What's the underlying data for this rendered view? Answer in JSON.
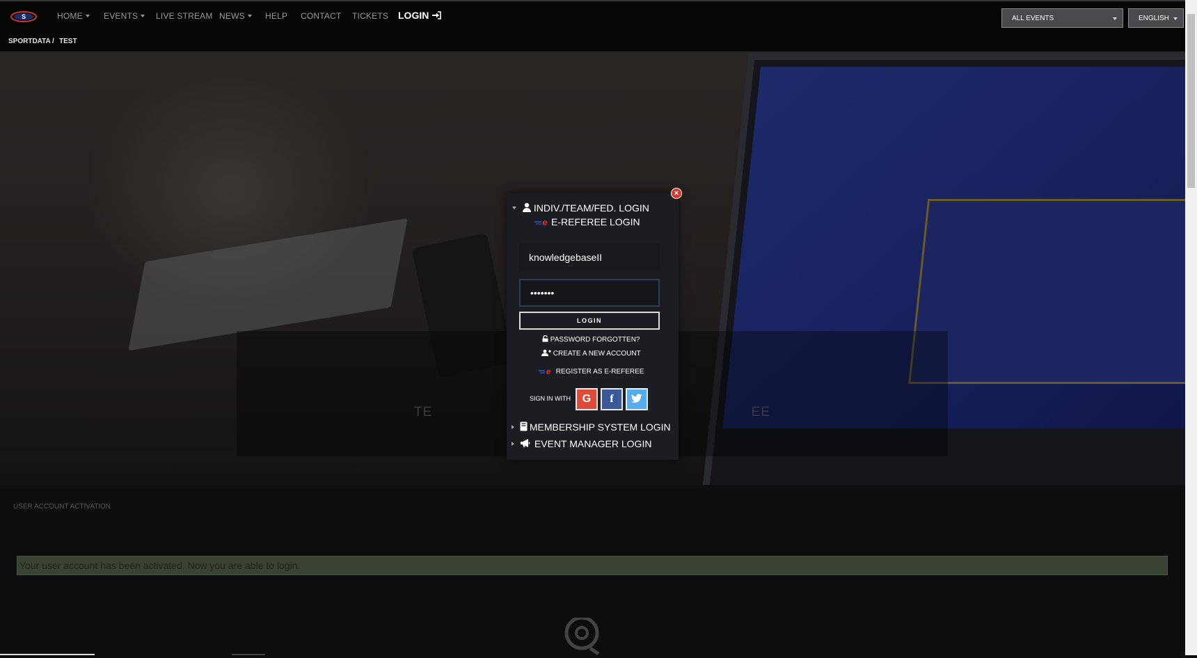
{
  "nav": {
    "home": "HOME",
    "events": "EVENTS",
    "live_stream": "LIVE STREAM",
    "news": "NEWS",
    "help": "HELP",
    "contact": "CONTACT",
    "tickets": "TICKETS",
    "login": "LOGIN",
    "event_select": "ALL EVENTS",
    "language_select": "ENGLISH"
  },
  "breadcrumb": [
    "SPORTDATA",
    "/",
    "TEST"
  ],
  "hero": {
    "title": "TE                                                                         EE"
  },
  "modal": {
    "indiv_login": "INDIV./TEAM/FED. LOGIN",
    "ereferee_login": "E-REFEREE LOGIN",
    "username_value": "knowledgebaseII",
    "password_value": "•••••••",
    "login_button": "LOGIN",
    "password_forgotten": "PASSWORD FORGOTTEN?",
    "create_account": "CREATE A NEW ACCOUNT",
    "register_ereferee": "REGISTER AS E-REFEREE",
    "sign_in_with": "SIGN IN WITH",
    "google": "G",
    "facebook": "f",
    "membership_login": "MEMBERSHIP SYSTEM LOGIN",
    "event_manager_login": "EVENT MANAGER LOGIN"
  },
  "section": {
    "label": "USER ACCOUNT ACTIVATION",
    "alert": "Your user account has been activated. Now you are able to login."
  },
  "colors": {
    "google": "#dd4b39",
    "facebook": "#3b5998",
    "twitter": "#55acee",
    "alert_bg": "#3a4233",
    "close": "#d43b30"
  }
}
